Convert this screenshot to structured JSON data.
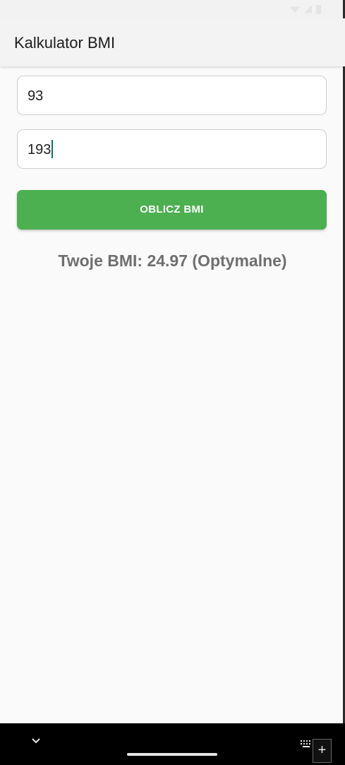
{
  "app_bar": {
    "title": "Kalkulator BMI"
  },
  "form": {
    "weight_value": "93",
    "height_value": "193",
    "submit_label": "OBLICZ BMI"
  },
  "result": {
    "text": "Twoje BMI: 24.97 (Optymalne)"
  },
  "nav_bar": {
    "add_symbol": "+"
  },
  "colors": {
    "accent": "#4caf50",
    "caret": "#00796b",
    "result_text": "#6f6f6f",
    "background": "#fafafa"
  },
  "icons": {
    "status": [
      "wifi-icon",
      "signal-icon",
      "battery-icon"
    ],
    "nav": [
      "chevron-down-icon",
      "keyboard-icon",
      "add-icon"
    ]
  }
}
